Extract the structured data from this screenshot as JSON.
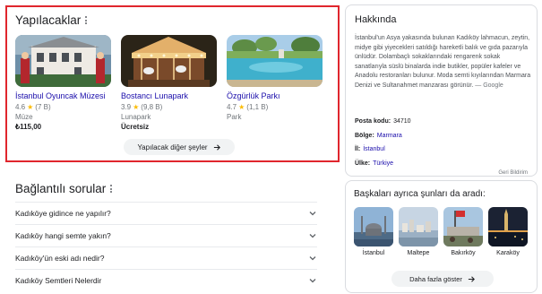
{
  "things_to_do": {
    "title": "Yapılacaklar",
    "cards": [
      {
        "name": "İstanbul Oyuncak Müzesi",
        "rating": "4.6",
        "reviews": "(7 B)",
        "type": "Müze",
        "price": "₺115,00"
      },
      {
        "name": "Bostancı Lunapark",
        "rating": "3.9",
        "reviews": "(9,8 B)",
        "type": "Lunapark",
        "price": "Ücretsiz"
      },
      {
        "name": "Özgürlük Parkı",
        "rating": "4.7",
        "reviews": "(1,1 B)",
        "type": "Park",
        "price": ""
      }
    ],
    "more_label": "Yapılacak diğer şeyler"
  },
  "related_questions": {
    "title": "Bağlantılı sorular",
    "items": [
      "Kadıköye gidince ne yapılır?",
      "Kadıköy hangi semte yakın?",
      "Kadıköy'ün eski adı nedir?",
      "Kadıköy Semtleri Nelerdir"
    ]
  },
  "about": {
    "title": "Hakkında",
    "description": "İstanbul'un Asya yakasında bulunan Kadıköy lahmacun, zeytin, midye gibi yiyecekleri satıldığı hareketli balık ve gıda pazarıyla ünlüdür. Dolambaçlı sokaklarındaki rengarenk sokak sanatlarıyla süslü binalarda indie butikler, popüler kafeler ve Anadolu restoranları bulunur. Moda semti kıyılarından Marmara Denizi ve Sultanahmet manzarası görünür.",
    "source": "— Google",
    "facts": [
      {
        "label": "Posta kodu:",
        "value": "34710",
        "link": false
      },
      {
        "label": "Bölge:",
        "value": "Marmara",
        "link": true
      },
      {
        "label": "İl:",
        "value": "İstanbul",
        "link": true
      },
      {
        "label": "Ülke:",
        "value": "Türkiye",
        "link": true
      }
    ],
    "feedback": "Geri Bildirim"
  },
  "people_also_search": {
    "title": "Başkaları ayrıca şunları da aradı:",
    "items": [
      "İstanbul",
      "Maltepe",
      "Bakırköy",
      "Karaköy"
    ],
    "show_more_label": "Daha fazla göster"
  },
  "colors": {
    "highlight_border": "#e0262d",
    "link": "#1a0dab",
    "star": "#fbbc04"
  }
}
